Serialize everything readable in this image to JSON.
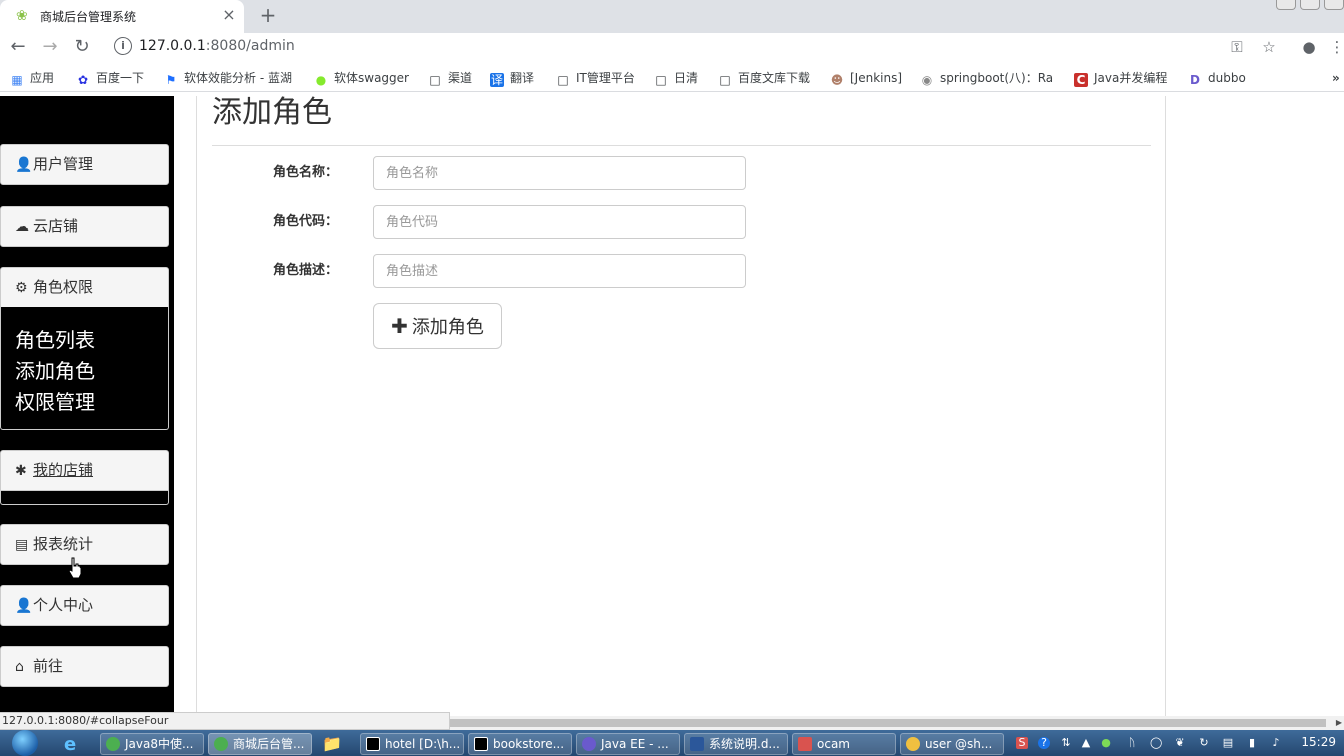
{
  "browser": {
    "tab_title": "商城后台管理系统",
    "url_host": "127.0.0.1",
    "url_rest": ":8080/admin"
  },
  "bookmarks": [
    {
      "label": "应用",
      "icon": "apps-grid-icon"
    },
    {
      "label": "百度一下",
      "icon": "baidu-paw-icon"
    },
    {
      "label": "软体效能分析 - 蓝湖",
      "icon": "lanhu-icon"
    },
    {
      "label": "软体swagger",
      "icon": "swagger-icon"
    },
    {
      "label": "渠道",
      "icon": "page-icon"
    },
    {
      "label": "翻译",
      "icon": "translate-icon"
    },
    {
      "label": "IT管理平台",
      "icon": "page-icon"
    },
    {
      "label": "日清",
      "icon": "page-icon"
    },
    {
      "label": "百度文库下载",
      "icon": "page-icon"
    },
    {
      "label": "[Jenkins]",
      "icon": "jenkins-icon"
    },
    {
      "label": "springboot(八)：Ra",
      "icon": "springboot-icon"
    },
    {
      "label": "Java并发编程",
      "icon": "csdn-icon"
    },
    {
      "label": "dubbo",
      "icon": "dubbo-icon"
    }
  ],
  "sidebar": {
    "items": [
      {
        "label": "用户管理",
        "icon": "user-icon"
      },
      {
        "label": "云店铺",
        "icon": "cloud-icon"
      },
      {
        "label": "角色权限",
        "icon": "cog-icon"
      },
      {
        "label": "我的店铺",
        "icon": "asterisk-icon"
      },
      {
        "label": "报表统计",
        "icon": "list-alt-icon"
      },
      {
        "label": "个人中心",
        "icon": "user-icon"
      },
      {
        "label": "前往",
        "icon": "home-icon"
      }
    ],
    "submenu": [
      "角色列表",
      "添加角色",
      "权限管理"
    ]
  },
  "main": {
    "title": "添加角色",
    "fields": [
      {
        "label": "角色名称：",
        "placeholder": "角色名称"
      },
      {
        "label": "角色代码：",
        "placeholder": "角色代码"
      },
      {
        "label": "角色描述：",
        "placeholder": "角色描述"
      }
    ],
    "submit_label": "添加角色"
  },
  "status_url": "127.0.0.1:8080/#collapseFour",
  "taskbar": {
    "tasks": [
      {
        "label": "Java8中使...",
        "color": "#4caf50"
      },
      {
        "label": "商城后台管...",
        "color": "#4caf50"
      },
      {
        "label": "hotel [D:\\h...",
        "color": "#000000"
      },
      {
        "label": "bookstore...",
        "color": "#000000"
      },
      {
        "label": "Java EE - ...",
        "color": "#6a5acd"
      },
      {
        "label": "系统说明.d...",
        "color": "#2b579a"
      },
      {
        "label": "ocam",
        "color": "#d9534f"
      },
      {
        "label": "user @sh...",
        "color": "#f0c040"
      }
    ],
    "time": "15:29"
  }
}
